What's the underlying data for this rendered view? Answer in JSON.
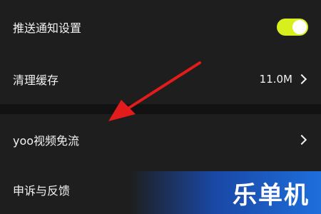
{
  "settings": {
    "push_notification": {
      "label": "推送通知设置",
      "enabled": true
    },
    "clear_cache": {
      "label": "清理缓存",
      "value": "11.0M"
    },
    "yoo_free": {
      "label": "yoo视频免流"
    },
    "complaint": {
      "label": "申诉与反馈"
    }
  },
  "colors": {
    "toggle_on": "#d8ef1e",
    "arrow": "#e31b1b",
    "row_bg": "#1e1e1e"
  },
  "watermark": {
    "text": "乐单机"
  }
}
